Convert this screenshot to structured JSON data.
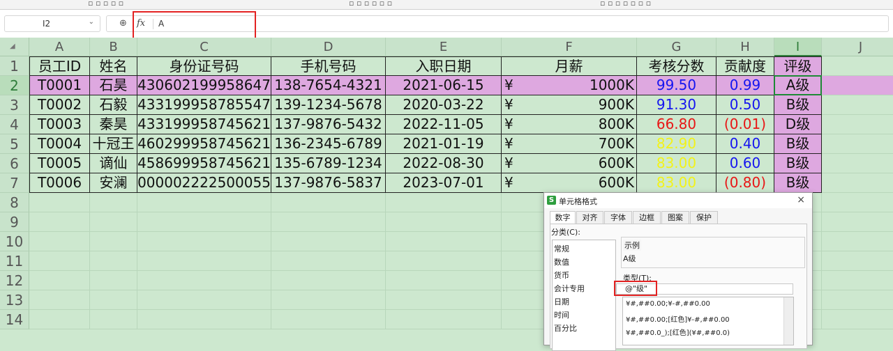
{
  "namebox": {
    "value": "I2"
  },
  "formula": {
    "value": "A"
  },
  "columns": [
    "A",
    "B",
    "C",
    "D",
    "E",
    "F",
    "G",
    "H",
    "I",
    "J"
  ],
  "rows": [
    "1",
    "2",
    "3",
    "4",
    "5",
    "6",
    "7",
    "8",
    "9",
    "10",
    "11",
    "12",
    "13",
    "14"
  ],
  "headers": [
    "员工ID",
    "姓名",
    "身份证号码",
    "手机号码",
    "入职日期",
    "月薪",
    "考核分数",
    "贡献度",
    "评级"
  ],
  "data_rows": [
    {
      "id": "T0001",
      "name": "石昊",
      "idcard": "430602199958647",
      "phone": "138-7654-4321",
      "date": "2021-06-15",
      "currency": "¥",
      "salary": "1000K",
      "score": "99.50",
      "score_color": "#1515f0",
      "contrib": "0.99",
      "contrib_color": "#1515f0",
      "grade": "A级"
    },
    {
      "id": "T0002",
      "name": "石毅",
      "idcard": "433199958785547",
      "phone": "139-1234-5678",
      "date": "2020-03-22",
      "currency": "¥",
      "salary": "900K",
      "score": "91.30",
      "score_color": "#1515f0",
      "contrib": "0.50",
      "contrib_color": "#1515f0",
      "grade": "B级"
    },
    {
      "id": "T0003",
      "name": "秦昊",
      "idcard": "433199958745621",
      "phone": "137-9876-5432",
      "date": "2022-11-05",
      "currency": "¥",
      "salary": "800K",
      "score": "66.80",
      "score_color": "#e81616",
      "contrib": "(0.01)",
      "contrib_color": "#e81616",
      "grade": "D级"
    },
    {
      "id": "T0004",
      "name": "十冠王",
      "idcard": "460299958745621",
      "phone": "136-2345-6789",
      "date": "2021-01-19",
      "currency": "¥",
      "salary": "700K",
      "score": "82.90",
      "score_color": "#f2f21a",
      "contrib": "0.40",
      "contrib_color": "#1515f0",
      "grade": "B级"
    },
    {
      "id": "T0005",
      "name": "谪仙",
      "idcard": "458699958745621",
      "phone": "135-6789-1234",
      "date": "2022-08-30",
      "currency": "¥",
      "salary": "600K",
      "score": "83.00",
      "score_color": "#f2f21a",
      "contrib": "0.60",
      "contrib_color": "#1515f0",
      "grade": "B级"
    },
    {
      "id": "T0006",
      "name": "安澜",
      "idcard": "000002222500055",
      "phone": "137-9876-5837",
      "date": "2023-07-01",
      "currency": "¥",
      "salary": "600K",
      "score": "83.00",
      "score_color": "#f2f21a",
      "contrib": "(0.80)",
      "contrib_color": "#e81616",
      "grade": "B级"
    }
  ],
  "dialog": {
    "title": "单元格格式",
    "logo": "S",
    "close": "×",
    "tabs": [
      "数字",
      "对齐",
      "字体",
      "边框",
      "图案",
      "保护"
    ],
    "category_label": "分类(C):",
    "categories": [
      "常规",
      "数值",
      "货币",
      "会计专用",
      "日期",
      "时间",
      "百分比"
    ],
    "sample_label": "示例",
    "sample_value": "A级",
    "type_label": "类型(T):",
    "type_value": "@\"级\"",
    "formats": [
      "¥#,##0.00;¥-#,##0.00",
      "¥#,##0.00;[红色]¥-#,##0.00",
      "¥#,##0.0_);[红色](¥#,##0.0)"
    ]
  },
  "colors": {
    "grid_bg": "#cde8cf",
    "highlight": "#dea8e0",
    "active": "#1d8a36",
    "annotation": "#e32222"
  }
}
